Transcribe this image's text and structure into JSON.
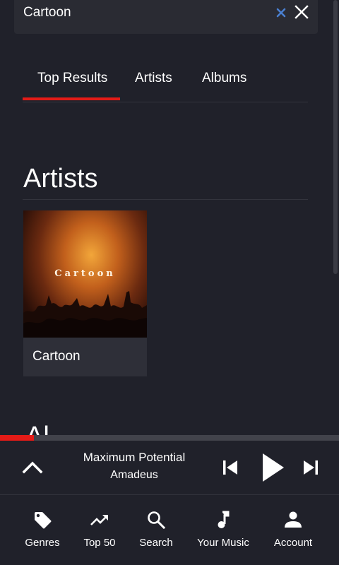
{
  "search": {
    "value": "Cartoon",
    "clear_icon": "clear-x-icon",
    "close_icon": "close-icon"
  },
  "tabs": [
    {
      "label": "Top Results",
      "active": true
    },
    {
      "label": "Artists",
      "active": false
    },
    {
      "label": "Albums",
      "active": false
    }
  ],
  "artists_section": {
    "heading": "Artists",
    "items": [
      {
        "name": "Cartoon",
        "art_text": "Cartoon"
      }
    ]
  },
  "albums_section": {
    "heading": "Al"
  },
  "player": {
    "progress_fraction": 0.1,
    "title": "Maximum Potential",
    "artist": "Amadeus",
    "accent_color": "#e41b17"
  },
  "bottom_nav": [
    {
      "label": "Genres",
      "icon": "tag-icon"
    },
    {
      "label": "Top 50",
      "icon": "trending-up-icon"
    },
    {
      "label": "Search",
      "icon": "search-icon"
    },
    {
      "label": "Your Music",
      "icon": "music-note-icon"
    },
    {
      "label": "Account",
      "icon": "person-icon"
    }
  ]
}
